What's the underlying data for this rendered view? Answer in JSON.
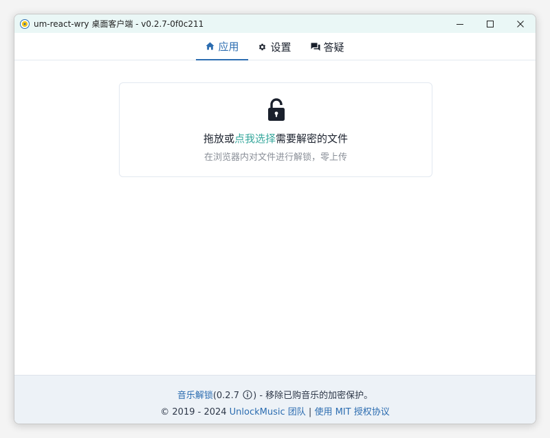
{
  "window": {
    "title": "um-react-wry 桌面客户端 - v0.2.7-0f0c211",
    "controls": [
      "minimize-icon",
      "maximize-icon",
      "close-icon"
    ]
  },
  "tabs": [
    {
      "label": "应用",
      "icon": "home-icon",
      "active": true
    },
    {
      "label": "设置",
      "icon": "gear-icon",
      "active": false
    },
    {
      "label": "答疑",
      "icon": "chat-icon",
      "active": false
    }
  ],
  "dropzone": {
    "icon": "unlock-icon",
    "title_prefix": "拖放或",
    "title_link": "点我选择",
    "title_suffix": "需要解密的文件",
    "subtitle": "在浏览器内对文件进行解锁，零上传"
  },
  "footer": {
    "app_name": "音乐解锁",
    "version_open": "(0.2.7",
    "version_close": ")",
    "tagline": " - 移除已购音乐的加密保护。",
    "copyright": "© 2019 - 2024 ",
    "team_link": "UnlockMusic 团队",
    "separator": " | ",
    "license_link": "使用 MIT 授权协议"
  },
  "colors": {
    "accent": "#2b6cb0",
    "link_teal": "#38a89d",
    "titlebar_bg": "#eaf7f6",
    "footer_bg": "#edf2f7"
  }
}
